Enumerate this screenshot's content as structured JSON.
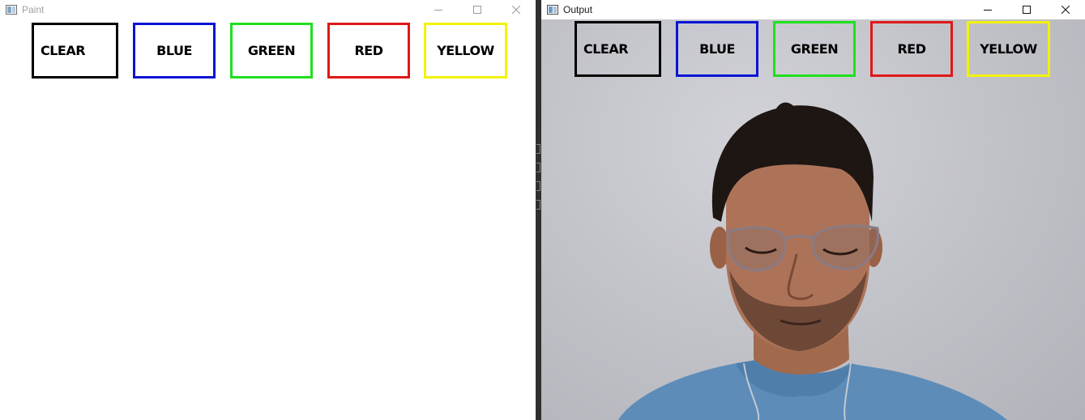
{
  "windows": {
    "paint": {
      "title": "Paint"
    },
    "output": {
      "title": "Output"
    }
  },
  "buttons": [
    {
      "label": "CLEAR",
      "color": "#000000"
    },
    {
      "label": "BLUE",
      "color": "#0a14d4"
    },
    {
      "label": "GREEN",
      "color": "#1fe01f"
    },
    {
      "label": "RED",
      "color": "#e01818"
    },
    {
      "label": "YELLOW",
      "color": "#f2f20a"
    }
  ],
  "window_controls": [
    "minimize-icon",
    "maximize-icon",
    "close-icon"
  ],
  "colors": {
    "paint_background": "#ffffff",
    "webcam_wall": "#c3c4ca",
    "shirt": "#5a8ab8"
  }
}
